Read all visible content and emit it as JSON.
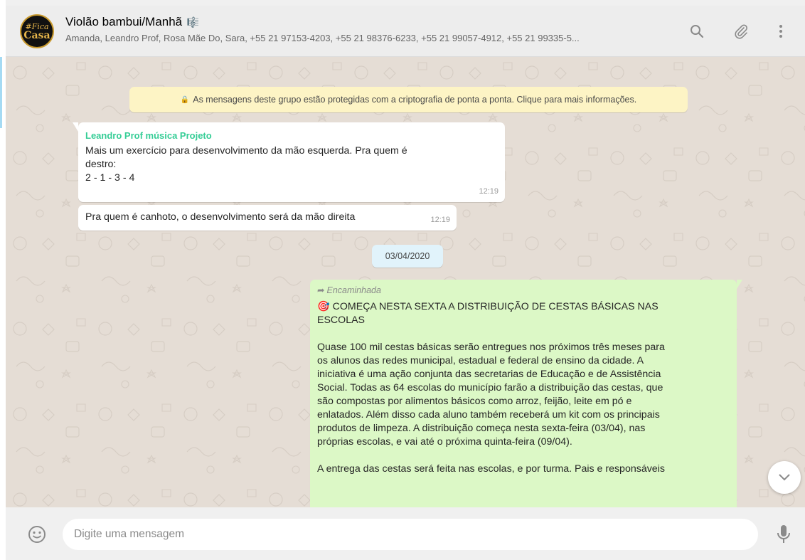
{
  "header": {
    "title": "Violão bambui/Manhã",
    "title_emoji": "🎼",
    "members": "Amanda, Leandro Prof, Rosa Mãe Do, Sara, +55 21 97153-4203, +55 21 98376-6233, +55 21 99057-4912, +55 21 99335-5...",
    "avatar_line1": "#Fica",
    "avatar_line2": "Casa"
  },
  "chat": {
    "encryption_note": "As mensagens deste grupo estão protegidas com a criptografia de ponta a ponta. Clique para mais informações.",
    "messages": [
      {
        "sender": "Leandro Prof música Projeto",
        "lines": [
          "Mais um exercício para desenvolvimento da mão esquerda. Pra quem é",
          "destro:",
          "2 - 1 - 3 - 4"
        ],
        "time": "12:19"
      },
      {
        "text": "Pra quem é canhoto, o desenvolvimento será da mão direita",
        "time": "12:19"
      }
    ],
    "date_chip": "03/04/2020",
    "forwarded": {
      "label": "Encaminhada",
      "icon": "🎯",
      "title_line1": "COMEÇA NESTA SEXTA A DISTRIBUIÇÃO DE CESTAS BÁSICAS NAS",
      "title_line2": "ESCOLAS",
      "para1": [
        "Quase 100 mil cestas básicas serão entregues nos próximos três meses para",
        "os alunos das redes municipal, estadual e federal de ensino da cidade. A",
        "iniciativa é uma ação conjunta das secretarias de Educação e de Assistência",
        "Social. Todas as 64 escolas do município farão a distribuição das cestas, que",
        "são compostas por alimentos básicos como arroz, feijão, leite em pó e",
        "enlatados. Além disso cada aluno também receberá um kit com os principais",
        "produtos de limpeza. A distribuição começa nesta sexta-feira (03/04), nas",
        "próprias escolas, e vai até o próxima quinta-feira (09/04)."
      ],
      "para2": "A entrega das cestas será feita nas escolas, e por turma. Pais e responsáveis"
    }
  },
  "footer": {
    "placeholder": "Digite uma mensagem"
  },
  "colors": {
    "sender": "#35cd96",
    "outgoing_bubble": "#dcf8c6",
    "chat_bg": "#e5ddd5",
    "encryption_bg": "#fdf4c5",
    "date_chip_bg": "#e1f3fb"
  },
  "icons": [
    "search-icon",
    "attach-icon",
    "menu-icon",
    "chevron-down-icon",
    "emoji-icon",
    "mic-icon",
    "lock-icon",
    "forward-icon"
  ]
}
